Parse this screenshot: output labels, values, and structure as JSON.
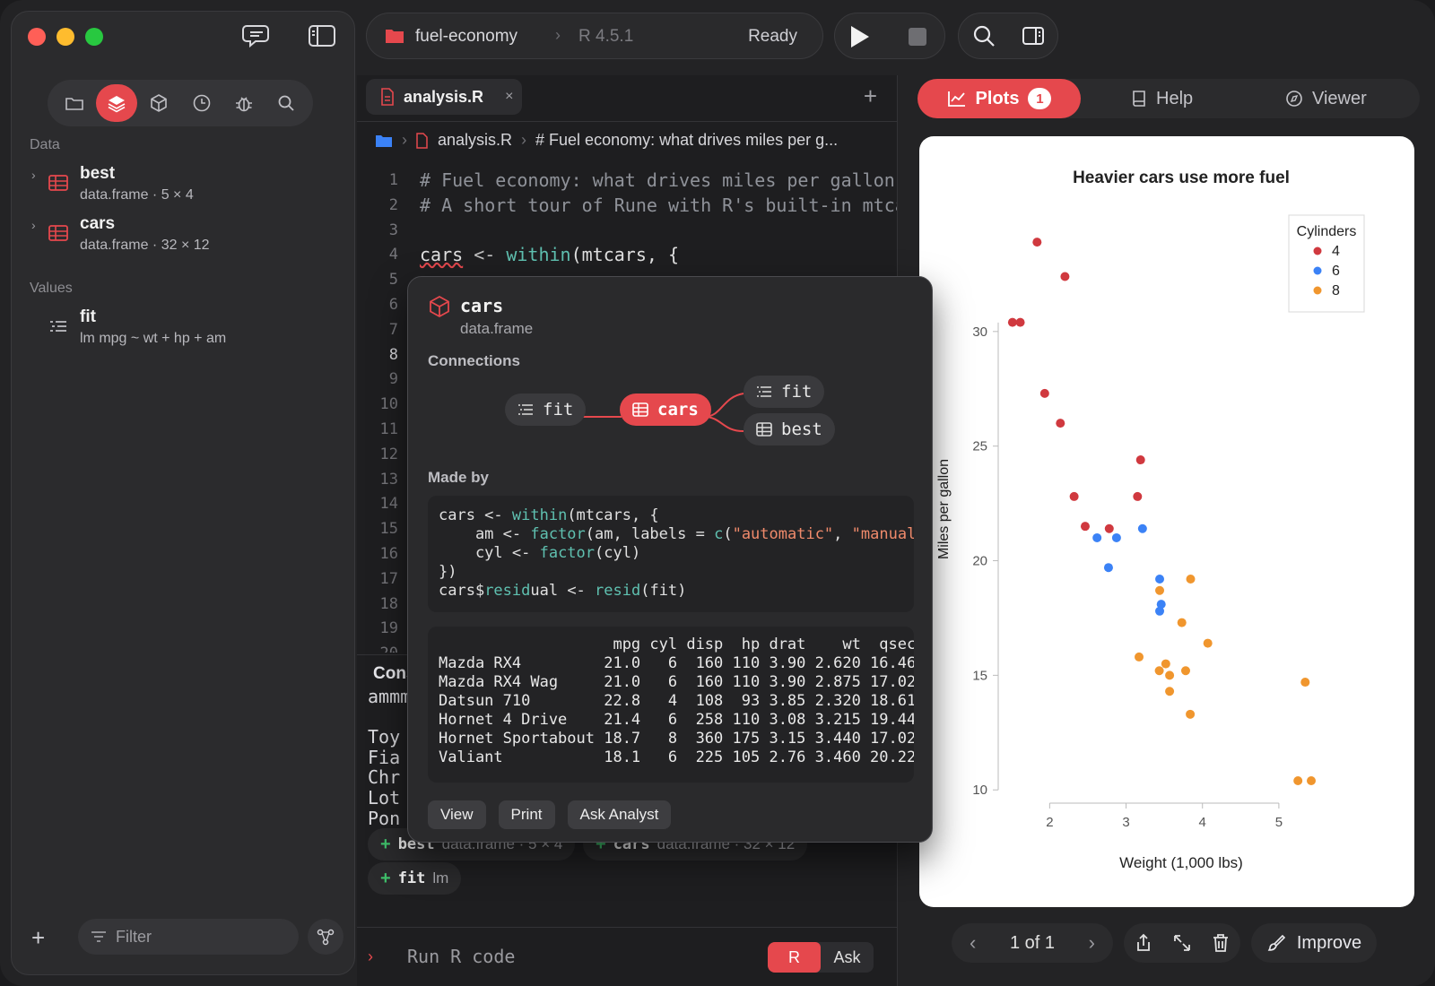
{
  "sidebar": {
    "tabs": [
      "folder-icon",
      "layers-icon",
      "package-icon",
      "history-icon",
      "debug-icon",
      "search-icon"
    ],
    "data_heading": "Data",
    "values_heading": "Values",
    "data_items": [
      {
        "name": "best",
        "meta": "data.frame · 5 × 4"
      },
      {
        "name": "cars",
        "meta": "data.frame · 32 × 12"
      }
    ],
    "value_items": [
      {
        "name": "fit",
        "meta": "lm mpg ~ wt + hp + am"
      }
    ],
    "filter_placeholder": "Filter"
  },
  "toolbar": {
    "project": "fuel-economy",
    "separator": "›",
    "r_version": "R 4.5.1",
    "status": "Ready"
  },
  "editor": {
    "tab_label": "analysis.R",
    "tab_close": "×",
    "add_tab": "+",
    "breadcrumb_file": "analysis.R",
    "breadcrumb_symbol": "# Fuel economy: what drives miles per g...",
    "lines": [
      {
        "n": "1",
        "t": "# Fuel economy: what drives miles per gallon"
      },
      {
        "n": "2",
        "t": "# A short tour of Rune with R's built-in mtcars"
      },
      {
        "n": "3",
        "t": ""
      },
      {
        "n": "4",
        "t": "cars <- within(mtcars, {"
      },
      {
        "n": "5",
        "t": ""
      },
      {
        "n": "6",
        "t": ""
      },
      {
        "n": "7",
        "t": ""
      },
      {
        "n": "8",
        "t": ""
      },
      {
        "n": "9",
        "t": ""
      },
      {
        "n": "10",
        "t": ""
      },
      {
        "n": "11",
        "t": ""
      },
      {
        "n": "12",
        "t": ""
      },
      {
        "n": "13",
        "t": ""
      },
      {
        "n": "14",
        "t": ""
      },
      {
        "n": "15",
        "t": ""
      },
      {
        "n": "16",
        "t": ""
      },
      {
        "n": "17",
        "t": ""
      },
      {
        "n": "18",
        "t": ""
      },
      {
        "n": "19",
        "t": ""
      },
      {
        "n": "20",
        "t": ""
      }
    ],
    "line4": {
      "var": "cars",
      "op": " <- ",
      "fn": "within",
      "rest": "(mtcars, {"
    },
    "console_title": "Console",
    "console_lines": [
      "ammm",
      "",
      "Toy",
      "Fia",
      "Chr",
      "Lot",
      "Pon"
    ],
    "chips": [
      {
        "name": "best",
        "desc": "data.frame · 5 × 4"
      },
      {
        "name": "cars",
        "desc": "data.frame · 32 × 12"
      },
      {
        "name": "fit",
        "desc": "lm"
      }
    ],
    "prompt_placeholder": "Run R code",
    "mode_r": "R",
    "mode_ask": "Ask"
  },
  "popover": {
    "title": "cars",
    "subtitle": "data.frame",
    "connections_heading": "Connections",
    "nodes": {
      "left": "fit",
      "center": "cars",
      "right_top": "fit",
      "right_bottom": "best"
    },
    "made_by_heading": "Made by",
    "code_lines": [
      "cars <- within(mtcars, {",
      "    am <- factor(am, labels = c(\"automatic\", \"manual\"))",
      "    cyl <- factor(cyl)",
      "})",
      "cars$residual <- resid(fit)"
    ],
    "table_header": "                   mpg cyl disp  hp drat    wt  qsec",
    "table_rows": [
      "Mazda RX4         21.0   6  160 110 3.90 2.620 16.46",
      "Mazda RX4 Wag     21.0   6  160 110 3.90 2.875 17.02",
      "Datsun 710        22.8   4  108  93 3.85 2.320 18.61",
      "Hornet 4 Drive    21.4   6  258 110 3.08 3.215 19.44",
      "Hornet Sportabout 18.7   8  360 175 3.15 3.440 17.02",
      "Valiant           18.1   6  225 105 2.76 3.460 20.22"
    ],
    "buttons": [
      "View",
      "Print",
      "Ask Analyst"
    ]
  },
  "right_panel": {
    "tabs": {
      "plots": "Plots",
      "plots_badge": "1",
      "help": "Help",
      "viewer": "Viewer"
    },
    "pager": "1 of 1",
    "improve": "Improve"
  },
  "colors": {
    "accent": "#e5484d",
    "cyl4": "#d0393f",
    "cyl6": "#3b82f6",
    "cyl8": "#f0962e"
  },
  "chart_data": {
    "type": "scatter",
    "title": "Heavier cars use more fuel",
    "xlabel": "Weight (1,000 lbs)",
    "ylabel": "Miles per gallon",
    "xlim": [
      1.35,
      5.6
    ],
    "ylim": [
      9.5,
      35
    ],
    "xticks": [
      2,
      3,
      4,
      5
    ],
    "yticks": [
      10,
      15,
      20,
      25,
      30
    ],
    "grid": false,
    "legend_title": "Cylinders",
    "legend_placement": "top-right",
    "series": [
      {
        "name": "4",
        "color": "#d0393f",
        "points": [
          [
            1.513,
            30.4
          ],
          [
            1.615,
            30.4
          ],
          [
            1.835,
            33.9
          ],
          [
            2.2,
            32.4
          ],
          [
            1.935,
            27.3
          ],
          [
            2.14,
            26.0
          ],
          [
            2.32,
            22.8
          ],
          [
            2.465,
            21.5
          ],
          [
            2.78,
            21.4
          ],
          [
            3.19,
            24.4
          ],
          [
            3.15,
            22.8
          ]
        ]
      },
      {
        "name": "6",
        "color": "#3b82f6",
        "points": [
          [
            2.62,
            21.0
          ],
          [
            2.875,
            21.0
          ],
          [
            3.215,
            21.4
          ],
          [
            3.46,
            18.1
          ],
          [
            3.44,
            19.2
          ],
          [
            3.44,
            17.8
          ],
          [
            2.77,
            19.7
          ]
        ]
      },
      {
        "name": "8",
        "color": "#f0962e",
        "points": [
          [
            3.44,
            18.7
          ],
          [
            3.57,
            14.3
          ],
          [
            4.07,
            16.4
          ],
          [
            3.73,
            17.3
          ],
          [
            3.78,
            15.2
          ],
          [
            5.25,
            10.4
          ],
          [
            5.424,
            10.4
          ],
          [
            5.345,
            14.7
          ],
          [
            3.52,
            15.5
          ],
          [
            3.435,
            15.2
          ],
          [
            3.84,
            13.3
          ],
          [
            3.845,
            19.2
          ],
          [
            3.17,
            15.8
          ],
          [
            3.57,
            15.0
          ]
        ]
      }
    ]
  }
}
